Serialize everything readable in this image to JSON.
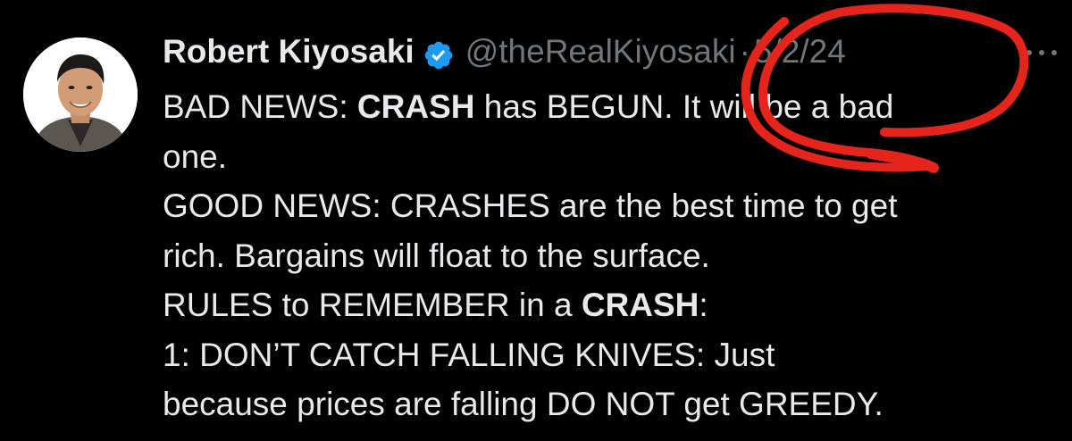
{
  "tweet": {
    "author": {
      "display_name": "Robert Kiyosaki",
      "handle": "@theRealKiyosaki",
      "verified": true,
      "avatar_icon": "profile-photo"
    },
    "separator": "·",
    "date": "5/2/24",
    "more_icon": "more-dots-icon",
    "lines": [
      {
        "before": "BAD NEWS: ",
        "bold": "CRASH",
        "after": " has BEGUN. It will be a bad"
      },
      {
        "text": "one."
      },
      {
        "text": "GOOD NEWS:  CRASHES are the best time to get"
      },
      {
        "text": "rich. Bargains will float to the surface."
      },
      {
        "before": "RULES to REMEMBER in a ",
        "bold": "CRASH",
        "after": ":"
      },
      {
        "text": "1:  DON’T CATCH FALLING KNIVES:  Just"
      },
      {
        "text": "because prices are falling DO NOT get GREEDY."
      }
    ]
  },
  "colors": {
    "background": "#000000",
    "primary_text": "#e7e9ea",
    "secondary_text": "#71767b",
    "verified_badge": "#1d9bf0",
    "annotation_circle": "#e5241b"
  }
}
